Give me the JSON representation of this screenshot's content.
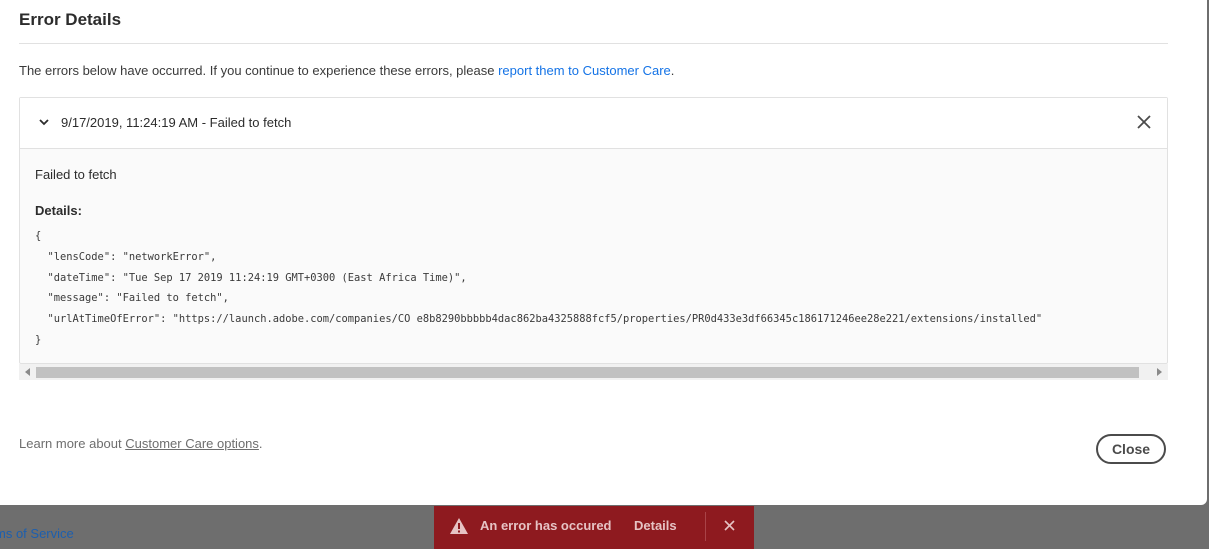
{
  "backdrop": {
    "link_text": "ms of Service"
  },
  "dialog": {
    "title": "Error Details",
    "intro_text": "The errors below have occurred. If you continue to experience these errors, please ",
    "intro_link": "report them to Customer Care",
    "intro_end": ".",
    "error": {
      "header": "9/17/2019, 11:24:19 AM - Failed to fetch",
      "message": "Failed to fetch",
      "details_label": "Details:",
      "details_json": "{\n  \"lensCode\": \"networkError\",\n  \"dateTime\": \"Tue Sep 17 2019 11:24:19 GMT+0300 (East Africa Time)\",\n  \"message\": \"Failed to fetch\",\n  \"urlAtTimeOfError\": \"https://launch.adobe.com/companies/CO e8b8290bbbbb4dac862ba4325888fcf5/properties/PR0d433e3df66345c186171246ee28e221/extensions/installed\"\n}"
    },
    "footer_text": "Learn more about ",
    "footer_link": "Customer Care options",
    "footer_end": ".",
    "close_label": "Close"
  },
  "toast": {
    "message": "An error has occured",
    "details_label": "Details",
    "bg_color": "#8e1a1f"
  }
}
